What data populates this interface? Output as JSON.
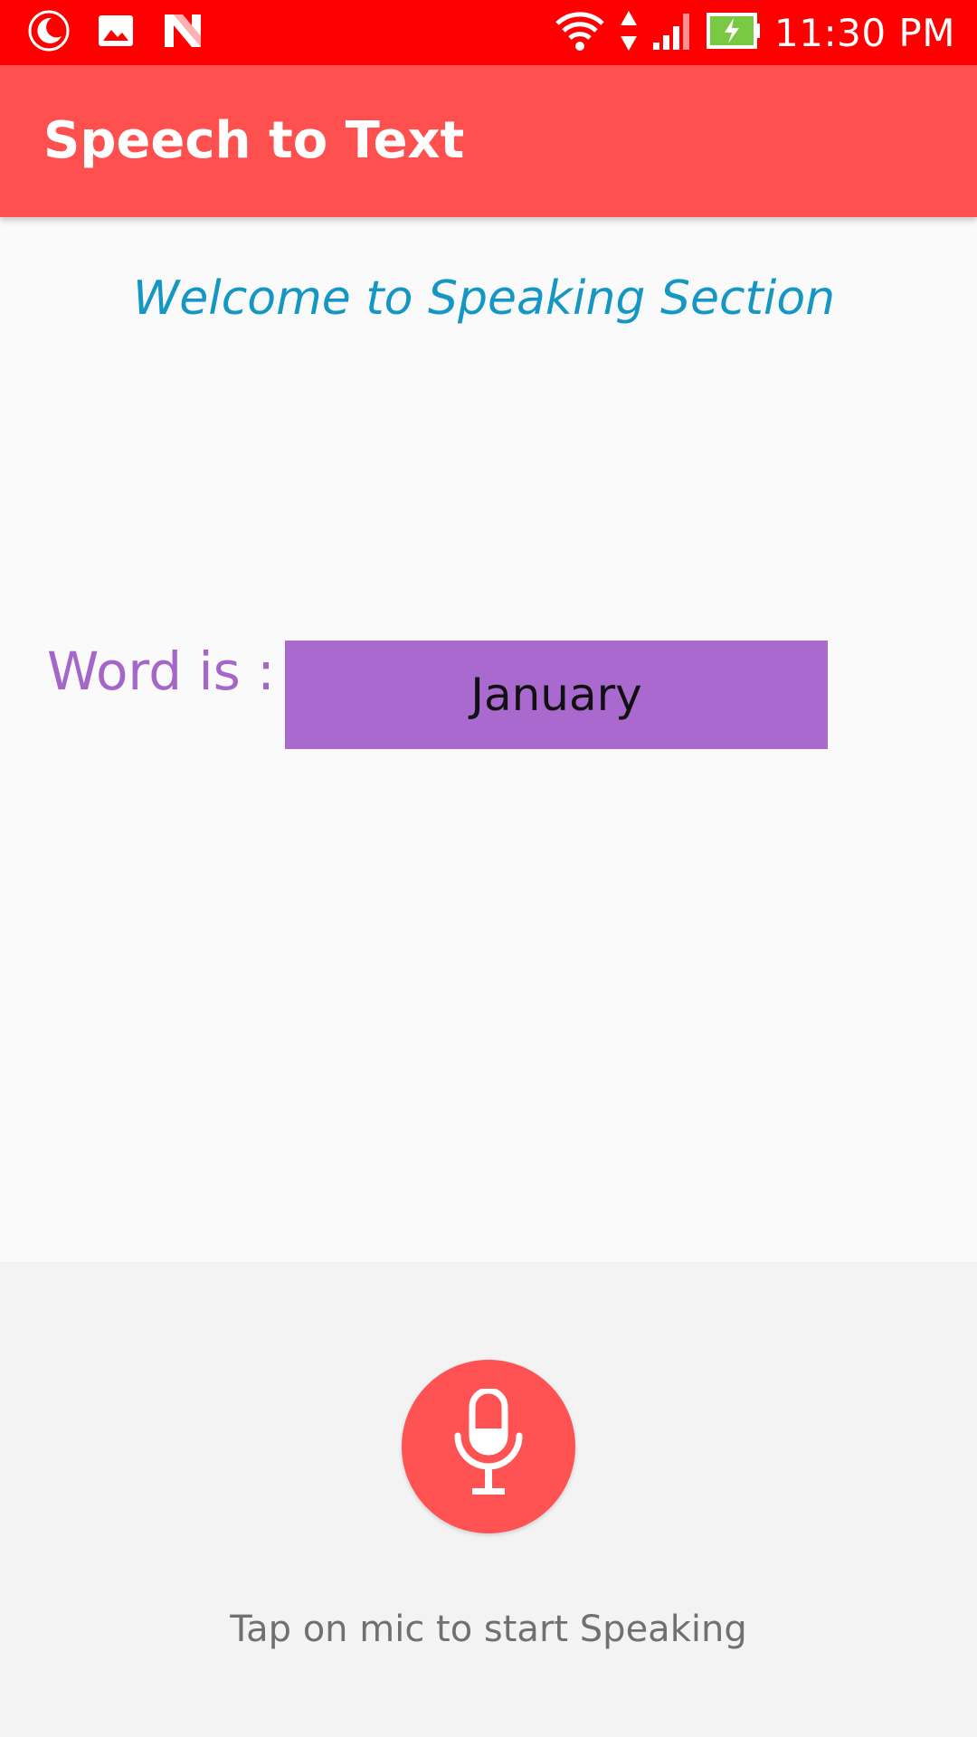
{
  "status_bar": {
    "time": "11:30 PM",
    "icons": [
      "moon-icon",
      "image-icon",
      "n-icon",
      "wifi-icon",
      "data-arrows-icon",
      "signal-icon",
      "battery-charging-icon"
    ],
    "background": "#ff0000"
  },
  "app_bar": {
    "title": "Speech to Text",
    "background": "#ff5050"
  },
  "main": {
    "welcome": "Welcome to Speaking Section",
    "word_label": "Word is :",
    "word_value": "January",
    "accent": "#a969cf"
  },
  "footer": {
    "mic_icon": "microphone-icon",
    "hint": "Tap on mic to start Speaking",
    "mic_color": "#ff5252"
  }
}
